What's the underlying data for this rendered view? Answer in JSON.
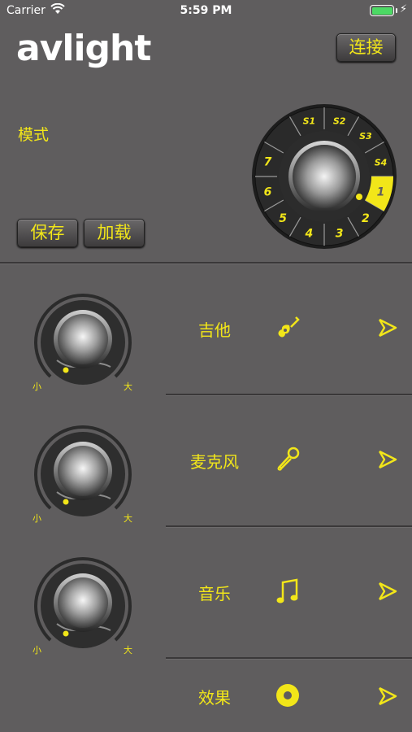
{
  "status_bar": {
    "carrier": "Carrier",
    "time": "5:59 PM"
  },
  "header": {
    "logo_text": "avlight",
    "connect_label": "连接"
  },
  "mode": {
    "label": "模式",
    "save_label": "保存",
    "load_label": "加载",
    "dial_positions": [
      "S1",
      "S2",
      "S3",
      "S4",
      "1",
      "2",
      "3",
      "4",
      "5",
      "6",
      "7"
    ],
    "selected_position": "1"
  },
  "channels": [
    {
      "name": "吉他",
      "icon": "guitar-icon",
      "min_label": "小",
      "max_label": "大"
    },
    {
      "name": "麦克风",
      "icon": "microphone-icon",
      "min_label": "小",
      "max_label": "大"
    },
    {
      "name": "音乐",
      "icon": "music-note-icon",
      "min_label": "小",
      "max_label": "大"
    },
    {
      "name": "效果",
      "icon": "effect-disc-icon"
    }
  ],
  "colors": {
    "accent": "#f2e619",
    "background": "#5f5d5e",
    "battery": "#4cd964"
  }
}
